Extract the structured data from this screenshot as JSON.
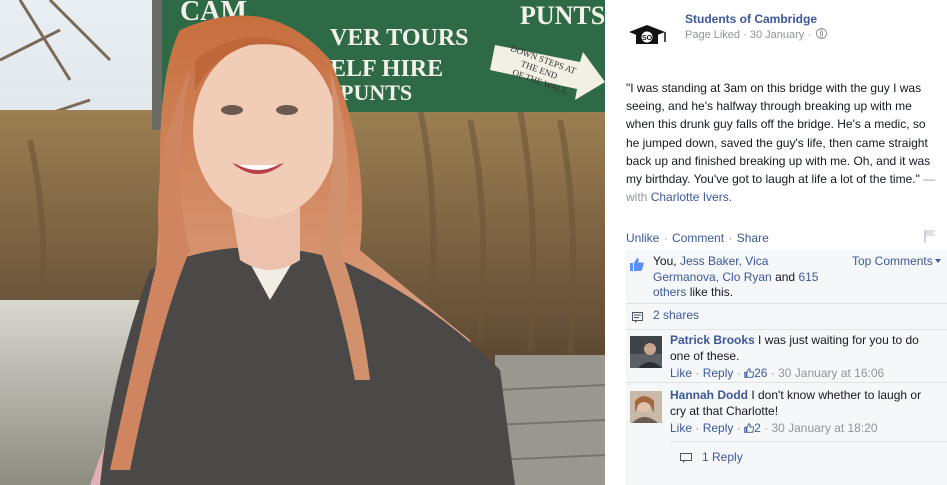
{
  "photo": {
    "sign": {
      "line1": "CAM",
      "line2": "VER TOURS",
      "line3": "ELF HIRE",
      "line4": "PUNTS",
      "top_right": "PUNTS",
      "arrow_line1": "DOWN STEPS AT",
      "arrow_line2": "THE END",
      "arrow_line3": "OF THE WALL"
    }
  },
  "post": {
    "page_name": "Students of Cambridge",
    "page_status": "Page Liked",
    "date": "30 January",
    "logo_text": "SO",
    "text": "\"I was standing at 3am on this bridge with the guy I was seeing, and he's halfway through breaking up with me when this drunk guy falls off the bridge. He's a medic, so he jumped down, saved the guy's life, then came straight back up and finished breaking up with me. Oh, and it was my birthday. You've got to laugh at life a lot of the time.\"",
    "with_prefix": "— with",
    "tagged": "Charlotte Ivers."
  },
  "actions": {
    "unlike": "Unlike",
    "comment": "Comment",
    "share": "Share",
    "dot": "·"
  },
  "likes": {
    "you": "You,",
    "names": "Jess Baker, Vica Germanova, Clo Ryan",
    "and": "and",
    "others": "615 others",
    "suffix": "like this.",
    "sort_label": "Top Comments"
  },
  "shares": {
    "label": "2 shares"
  },
  "comments": [
    {
      "author": "Patrick Brooks",
      "text": "I was just waiting for you to do one of these.",
      "like": "Like",
      "reply": "Reply",
      "likes_count": "26",
      "timestamp": "30 January at 16:06"
    },
    {
      "author": "Hannah Dodd",
      "text": "I don't know whether to laugh or cry at that Charlotte!",
      "like": "Like",
      "reply": "Reply",
      "likes_count": "2",
      "timestamp": "30 January at 18:20"
    }
  ],
  "reply_summary": "1 Reply",
  "colors": {
    "link": "#3b5998",
    "muted": "#90949c",
    "ufi_bg": "#f6f7f9",
    "sign_green": "#2f6a47"
  },
  "icons": [
    "globe-icon",
    "flag-icon",
    "thumbs-up-icon",
    "share-icon",
    "reply-icon"
  ]
}
